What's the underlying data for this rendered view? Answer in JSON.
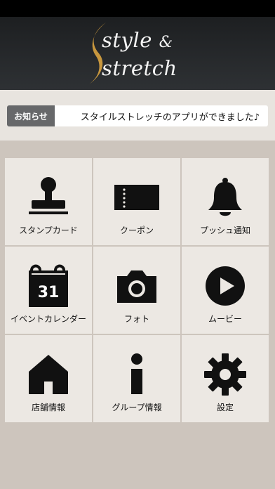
{
  "header": {
    "logo_line1": "style",
    "logo_amp": "&",
    "logo_line2": "stretch"
  },
  "notice": {
    "label": "お知らせ",
    "text": "スタイルストレッチのアプリができました♪"
  },
  "menu": [
    {
      "label": "スタンプカード",
      "icon": "stamp-icon"
    },
    {
      "label": "クーポン",
      "icon": "ticket-icon"
    },
    {
      "label": "プッシュ通知",
      "icon": "bell-icon"
    },
    {
      "label": "イベントカレンダー",
      "icon": "calendar-icon",
      "icon_text": "31"
    },
    {
      "label": "フォト",
      "icon": "camera-icon"
    },
    {
      "label": "ムービー",
      "icon": "play-icon"
    },
    {
      "label": "店舗情報",
      "icon": "house-icon"
    },
    {
      "label": "グループ情報",
      "icon": "info-icon"
    },
    {
      "label": "設定",
      "icon": "gear-icon"
    }
  ],
  "colors": {
    "header_bg": "#23262a",
    "logo_accent": "#c8973e",
    "notice_label_bg": "#67686a",
    "tile_bg": "#ece8e3",
    "page_bg": "#cdc5bd"
  }
}
